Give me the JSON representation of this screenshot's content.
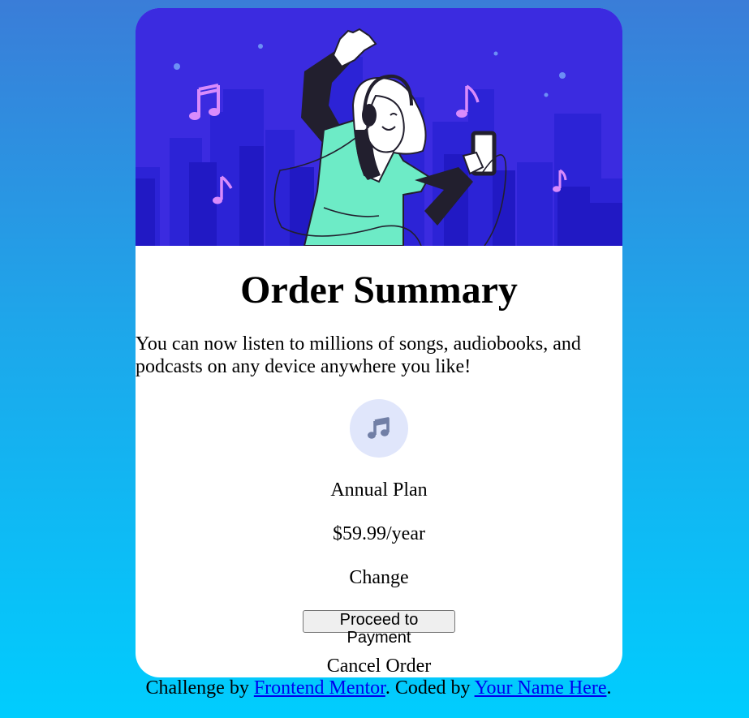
{
  "colors": {
    "page_gradient_top": "#3a7dd8",
    "page_gradient_bottom": "#00cdfe",
    "hero_background": "#3b2be0",
    "icon_circle": "#e0e6fb",
    "icon_glyph": "#717fa6",
    "link": "#0000ee"
  },
  "hero": {
    "illustration": "woman-listening-to-music-illustration"
  },
  "summary": {
    "title": "Order Summary",
    "description": "You can now listen to millions of songs, audiobooks, and podcasts on any device anywhere you like!"
  },
  "plan": {
    "icon": "music-note-icon",
    "name": "Annual Plan",
    "price": "$59.99/year",
    "change_label": "Change"
  },
  "actions": {
    "proceed_label": "Proceed to Payment",
    "cancel_label": "Cancel Order"
  },
  "attribution": {
    "prefix": "Challenge by ",
    "challenge_link": "Frontend Mentor",
    "middle": ". Coded by ",
    "author_link": "Your Name Here",
    "suffix": "."
  }
}
